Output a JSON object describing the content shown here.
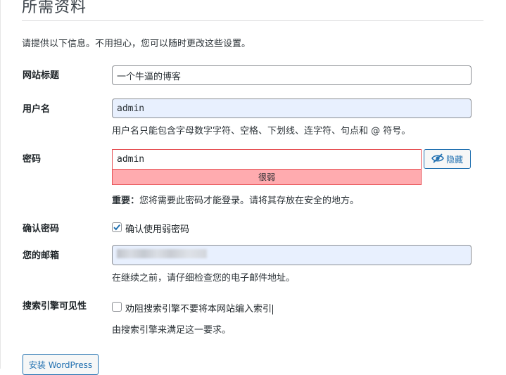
{
  "heading": "所需资料",
  "intro": "请提供以下信息。不用担心，您可以随时更改这些设置。",
  "site_title": {
    "label": "网站标题",
    "value": "一个牛逼的博客"
  },
  "username": {
    "label": "用户名",
    "value": "admin",
    "description": "用户名只能包含字母数字字符、空格、下划线、连字符、句点和 @ 符号。"
  },
  "password": {
    "label": "密码",
    "value": "admin",
    "strength": "很弱",
    "hide_label": "隐藏",
    "note_strong": "重要：",
    "note": "您将需要此密码才能登录。请将其存放在安全的地方。"
  },
  "confirm_password": {
    "label": "确认密码",
    "checkbox_label": "确认使用弱密码",
    "checked": true
  },
  "email": {
    "label": "您的邮箱",
    "description": "在继续之前，请仔细检查您的电子邮件地址。"
  },
  "search_visibility": {
    "label": "搜索引擎可见性",
    "checkbox_label": "劝阻搜索引擎不要将本网站编入索引",
    "checked": false,
    "description": "由搜索引擎来满足这一要求。"
  },
  "install_button": "安装 WordPress",
  "colors": {
    "accent": "#2271b1",
    "weak_meter_bg": "#ffabaf",
    "weak_meter_border": "#e65054",
    "autofill_bg": "#e8f0fe"
  },
  "icons": {
    "hide_password": "eye-slash-icon",
    "checkmark": "checkmark-icon"
  }
}
